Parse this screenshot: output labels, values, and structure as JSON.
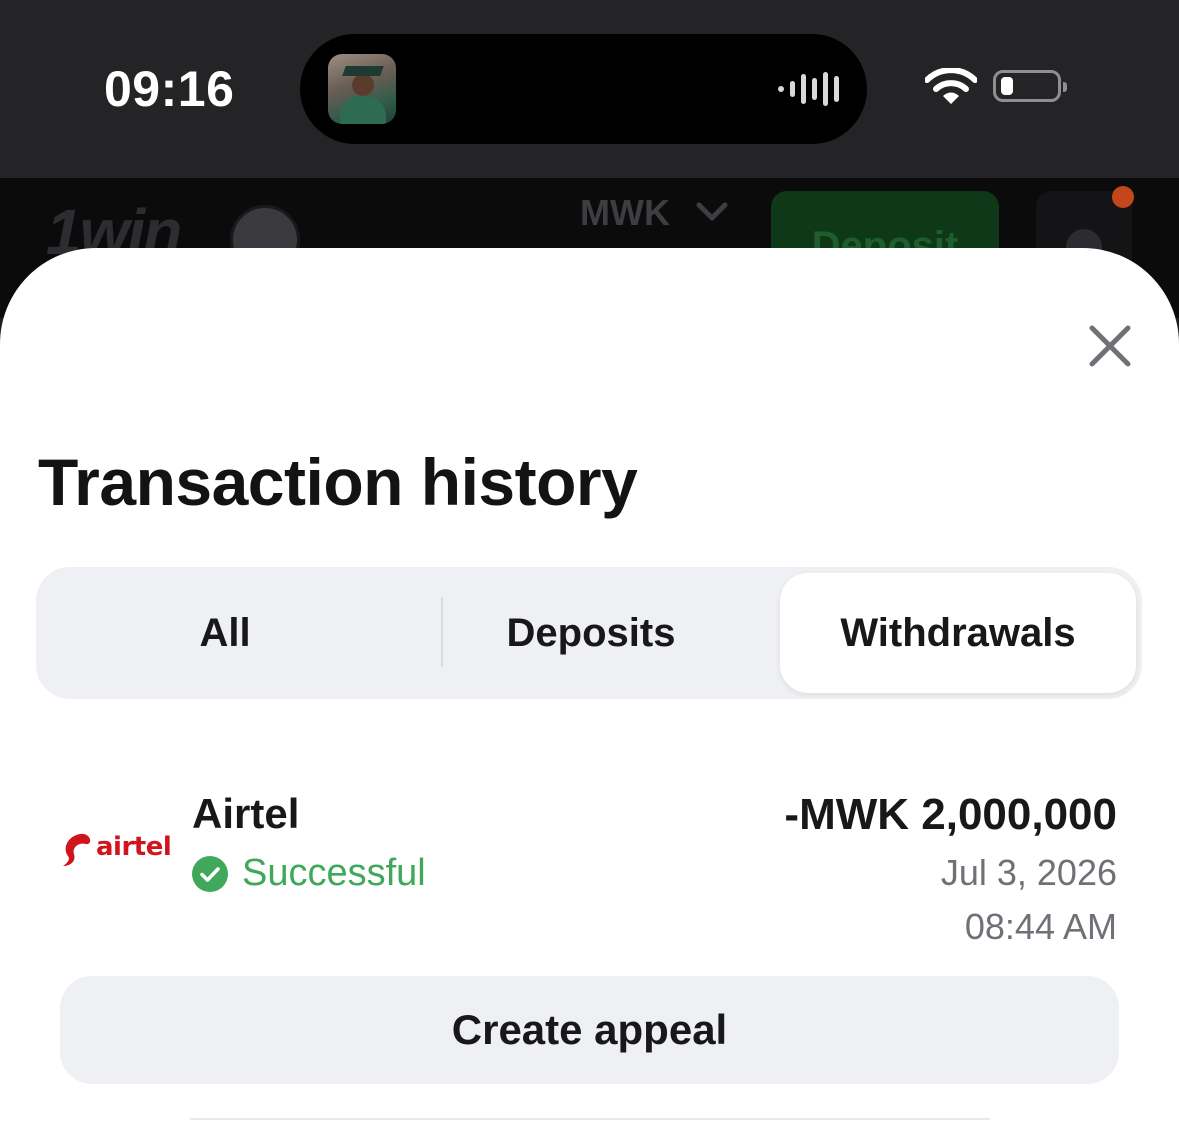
{
  "status_bar": {
    "time": "09:16",
    "icons": [
      "now-playing-art",
      "audio-waveform-icon",
      "wifi-icon",
      "battery-icon"
    ]
  },
  "app_header": {
    "brand": "1win",
    "currency": "MWK",
    "deposit_label": "Deposit",
    "icons": [
      "ball-icon",
      "chevron-down-icon",
      "bell-icon"
    ],
    "notification_dot_color": "#c4461c"
  },
  "sheet": {
    "title": "Transaction history",
    "close_icon": "close-icon",
    "tabs": [
      {
        "label": "All",
        "selected": false
      },
      {
        "label": "Deposits",
        "selected": false
      },
      {
        "label": "Withdrawals",
        "selected": true
      }
    ],
    "transactions": [
      {
        "logo_text": "airtel",
        "provider": "Airtel",
        "status": "Successful",
        "status_icon": "check-circle-icon",
        "amount": "-MWK 2,000,000",
        "date": "Jul 3, 2026",
        "time": "08:44 AM"
      }
    ],
    "appeal_label": "Create appeal"
  },
  "colors": {
    "success": "#3fa85a",
    "brand_red": "#d0141c",
    "segment_bg": "#eff0f3",
    "text_primary": "#18181b",
    "text_secondary": "#6f7177"
  }
}
